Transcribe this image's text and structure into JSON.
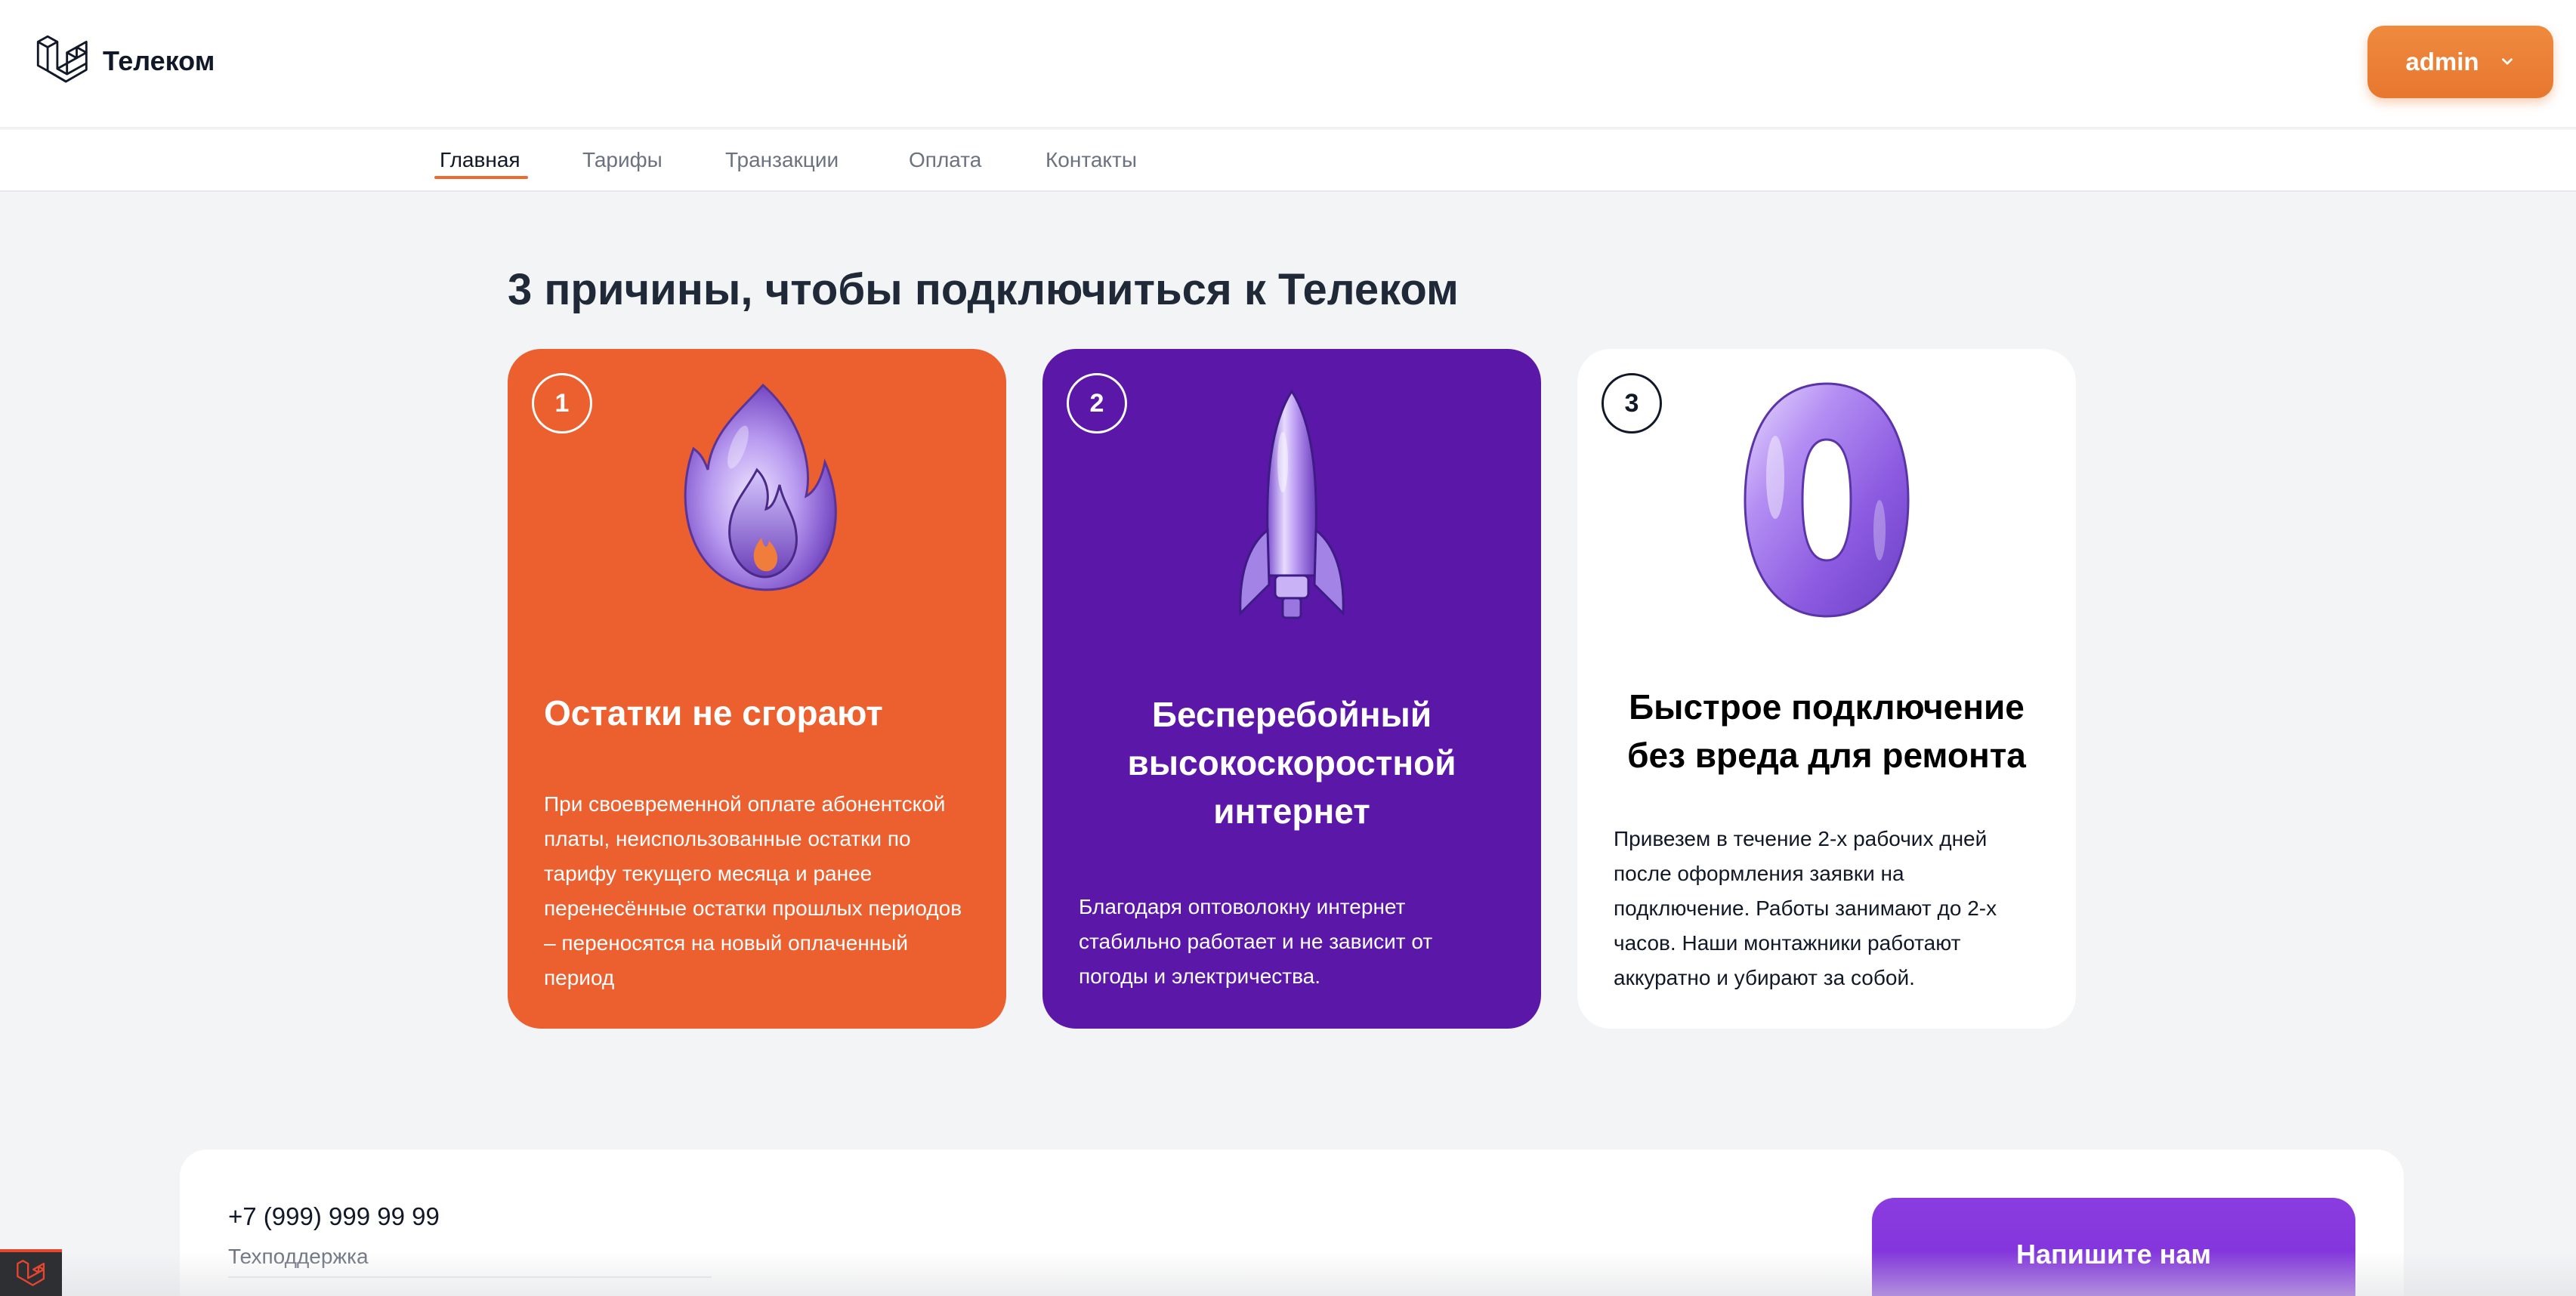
{
  "header": {
    "brand": "Телеком",
    "logo_icon": "laravel-logo-icon",
    "user_menu": {
      "label": "admin",
      "icon": "chevron-down-icon"
    }
  },
  "nav": {
    "items": [
      {
        "label": "Главная",
        "active": true
      },
      {
        "label": "Тарифы",
        "active": false
      },
      {
        "label": "Транзакции",
        "active": false
      },
      {
        "label": "Оплата",
        "active": false
      },
      {
        "label": "Контакты",
        "active": false
      }
    ]
  },
  "reasons": {
    "title": "3 причины, чтобы подключиться к Телеком",
    "cards": [
      {
        "number": "1",
        "illustration": "flame-illustration",
        "title": "Остатки не сгорают",
        "text": "При своевременной оплате абонентской платы, неиспользованные остатки по тарифу текущего месяца и ранее перенесённые остатки прошлых периодов – переносятся на новый оплаченный период",
        "color": "#ec5f2f"
      },
      {
        "number": "2",
        "illustration": "rocket-illustration",
        "title": "Бесперебойный высокоскоростной интернет",
        "text": "Благодаря оптоволокну интернет стабильно работает и не зависит от погоды и электричества.",
        "color": "#5b18a8"
      },
      {
        "number": "3",
        "illustration": "zero-balloon-illustration",
        "title": "Быстрое подключение без вреда для ремонта",
        "text": "Привезем в течение 2-х рабочих дней после оформления заявки на подключение. Работы занимают до 2-х часов. Наши монтажники работают аккуратно и убирают за собой.",
        "color": "#ffffff"
      }
    ]
  },
  "contact": {
    "phone": "+7 (999) 999 99 99",
    "phone_caption": "Техподдержка",
    "write_button": "Напишите нам"
  },
  "colors": {
    "accent_orange": "#ec5f2f",
    "accent_purple": "#5b18a8",
    "button_orange": "#e8772f",
    "button_purple": "#7b2fd6",
    "background": "#f3f4f6"
  }
}
